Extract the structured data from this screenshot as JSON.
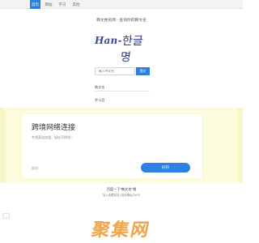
{
  "nav": {
    "items": [
      "首页",
      "网站",
      "学习",
      "其他"
    ],
    "active_index": 0,
    "accent": "#2f7fd8"
  },
  "site_title": "韩文姓名网 - 查询你的韩文名",
  "logo": {
    "latin": "Han-",
    "hangul": "한글명"
  },
  "search": {
    "placeholder": "输入中文名",
    "button_label": "提交"
  },
  "results": [
    "韩文名",
    "罗马音"
  ],
  "ad": {
    "headline": "跨境网络连接",
    "description": "专线直连加速，轻松不掉线！",
    "cancel_label": "取消",
    "confirm_label": "好的",
    "background": "#fcfcdc"
  },
  "footer": {
    "tip": "百度一下“韩文名”哦",
    "link": "加入收藏本站 | 保存网址Ctrl+D"
  },
  "bottom_logo": "聚集网"
}
